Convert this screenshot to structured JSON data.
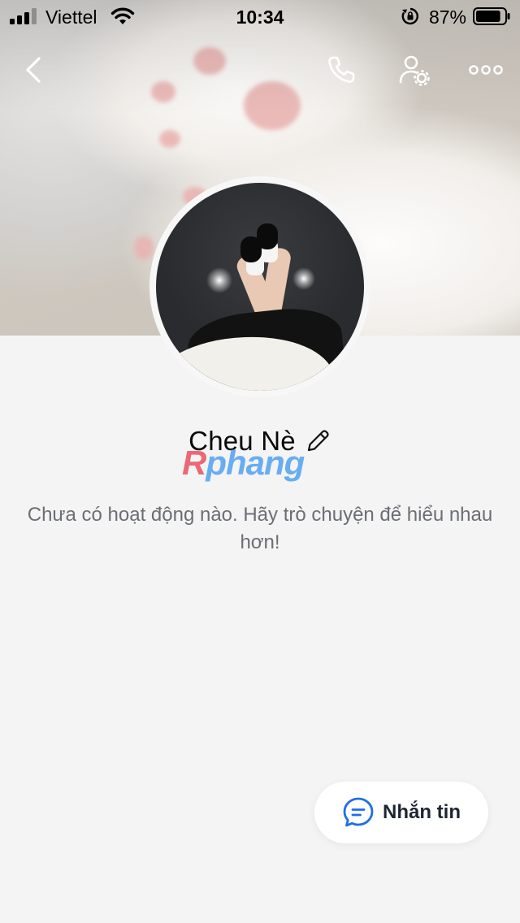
{
  "status_bar": {
    "carrier": "Viettel",
    "time": "10:34",
    "battery_percent": "87%",
    "battery_level": 0.87,
    "icons": [
      "signal-icon",
      "wifi-icon",
      "rotation-lock-icon",
      "battery-icon"
    ]
  },
  "top_nav": {
    "icons": [
      "back-arrow-icon",
      "phone-icon",
      "user-settings-icon",
      "more-options-icon"
    ]
  },
  "profile": {
    "name": "Cheu Nè",
    "empty_activity_message": "Chưa có hoạt động nào. Hãy trò chuyện để hiểu nhau hơn!"
  },
  "watermark": {
    "text_first": "R",
    "text_rest": "phang"
  },
  "message_button": {
    "label": "Nhắn tin",
    "icon": "chat-bubble-icon"
  },
  "colors": {
    "background": "#f4f4f5",
    "accent_blue": "#1e6ee8",
    "text_secondary": "#6b6e73"
  }
}
